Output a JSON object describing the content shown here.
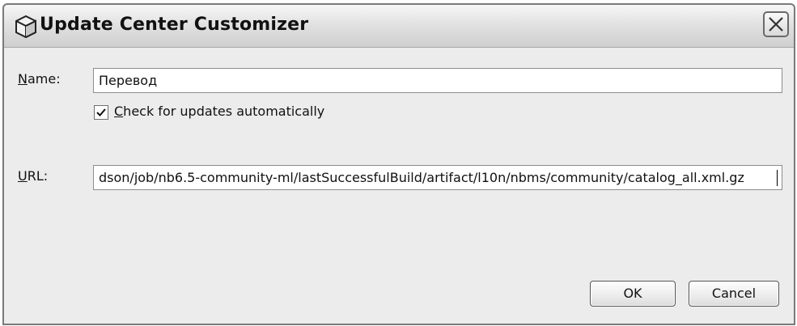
{
  "dialog": {
    "title": "Update Center Customizer"
  },
  "form": {
    "name_label_accel": "N",
    "name_label_rest": "ame:",
    "name_value": "Перевод",
    "check_accel": "C",
    "check_rest": "heck for updates automatically",
    "check_checked": true,
    "url_label_accel": "U",
    "url_label_rest": "RL:",
    "url_value": "dson/job/nb6.5-community-ml/lastSuccessfulBuild/artifact/l10n/nbms/community/catalog_all.xml.gz"
  },
  "buttons": {
    "ok": "OK",
    "cancel": "Cancel"
  },
  "icons": {
    "title": "nb-cube-icon",
    "close": "close-icon"
  }
}
